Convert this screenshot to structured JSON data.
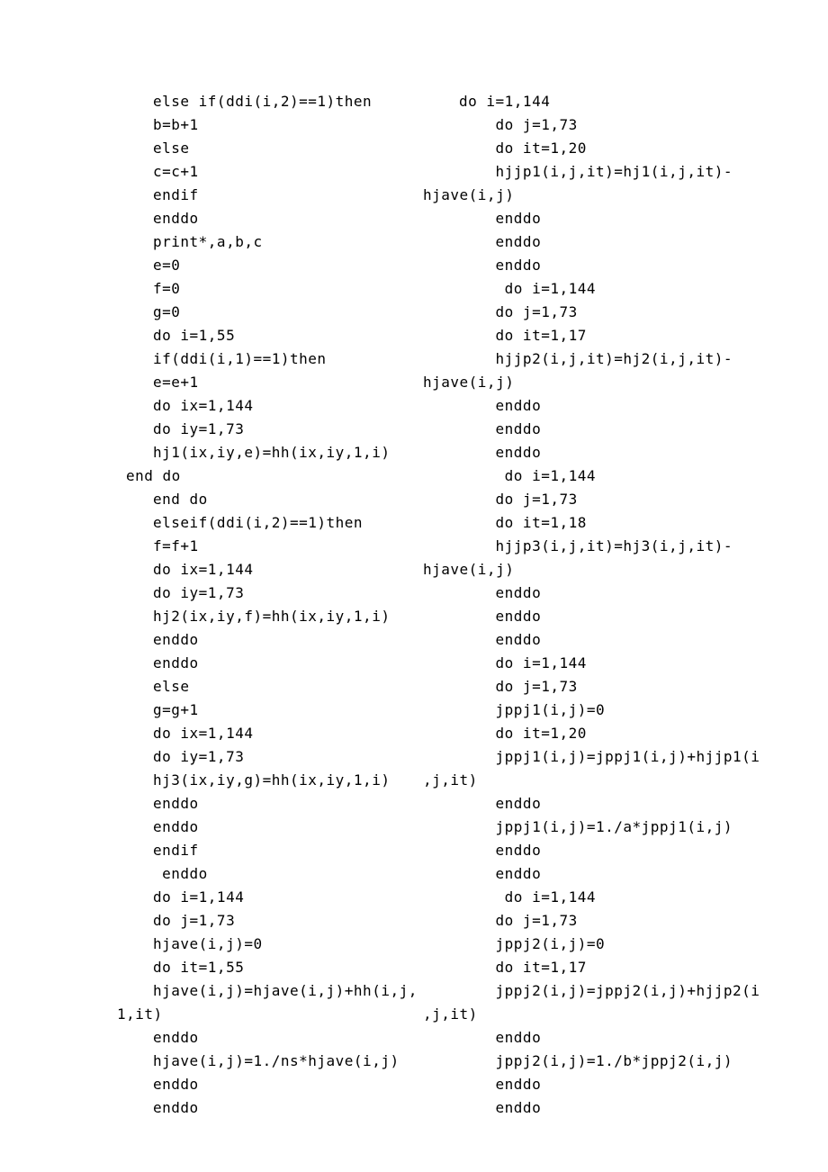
{
  "left": [
    {
      "cls": "indent",
      "t": "else if(ddi(i,2)==1)then"
    },
    {
      "cls": "indent",
      "t": "b=b+1"
    },
    {
      "cls": "indent",
      "t": "else"
    },
    {
      "cls": "indent",
      "t": "c=c+1"
    },
    {
      "cls": "indent",
      "t": "endif"
    },
    {
      "cls": "indent",
      "t": "enddo"
    },
    {
      "cls": "indent",
      "t": "print*,a,b,c"
    },
    {
      "cls": "indent",
      "t": "e=0"
    },
    {
      "cls": "indent",
      "t": "f=0"
    },
    {
      "cls": "indent",
      "t": "g=0"
    },
    {
      "cls": "indent",
      "t": "do i=1,55"
    },
    {
      "cls": "indent",
      "t": "if(ddi(i,1)==1)then"
    },
    {
      "cls": "indent",
      "t": "e=e+1"
    },
    {
      "cls": "indent",
      "t": "do ix=1,144"
    },
    {
      "cls": "indent",
      "t": "do iy=1,73"
    },
    {
      "cls": "indent",
      "t": "hj1(ix,iy,e)=hh(ix,iy,1,i)"
    },
    {
      "cls": "lessindent",
      "t": "end do"
    },
    {
      "cls": "indent",
      "t": "end do"
    },
    {
      "cls": "indent",
      "t": "elseif(ddi(i,2)==1)then"
    },
    {
      "cls": "indent",
      "t": "f=f+1"
    },
    {
      "cls": "indent",
      "t": "do ix=1,144"
    },
    {
      "cls": "indent",
      "t": "do iy=1,73"
    },
    {
      "cls": "indent",
      "t": "hj2(ix,iy,f)=hh(ix,iy,1,i)"
    },
    {
      "cls": "indent",
      "t": "enddo"
    },
    {
      "cls": "indent",
      "t": "enddo"
    },
    {
      "cls": "indent",
      "t": "else"
    },
    {
      "cls": "indent",
      "t": "g=g+1"
    },
    {
      "cls": "indent",
      "t": "do ix=1,144"
    },
    {
      "cls": "indent",
      "t": "do iy=1,73"
    },
    {
      "cls": "indent",
      "t": "hj3(ix,iy,g)=hh(ix,iy,1,i)"
    },
    {
      "cls": "indent",
      "t": "enddo"
    },
    {
      "cls": "indent",
      "t": "enddo"
    },
    {
      "cls": "indent",
      "t": "endif"
    },
    {
      "cls": "indent",
      "t": " enddo"
    },
    {
      "cls": "indent",
      "t": "do i=1,144"
    },
    {
      "cls": "indent",
      "t": "do j=1,73"
    },
    {
      "cls": "indent",
      "t": "hjave(i,j)=0"
    },
    {
      "cls": "indent",
      "t": "do it=1,55"
    },
    {
      "cls": "indent",
      "t": "hjave(i,j)=hjave(i,j)+hh(i,j,"
    },
    {
      "cls": "noindent",
      "t": "1,it)"
    },
    {
      "cls": "indent",
      "t": "enddo"
    },
    {
      "cls": "indent",
      "t": "hjave(i,j)=1./ns*hjave(i,j)"
    },
    {
      "cls": "indent",
      "t": "enddo"
    },
    {
      "cls": "indent",
      "t": "enddo"
    }
  ],
  "right": [
    {
      "cls": "indent",
      "t": "do i=1,144"
    },
    {
      "cls": "indent",
      "t": "    do j=1,73"
    },
    {
      "cls": "indent",
      "t": "    do it=1,20"
    },
    {
      "cls": "indent",
      "t": "    hjjp1(i,j,it)=hj1(i,j,it)-"
    },
    {
      "cls": "noindent",
      "t": "hjave(i,j)"
    },
    {
      "cls": "indent",
      "t": "    enddo"
    },
    {
      "cls": "indent",
      "t": "    enddo"
    },
    {
      "cls": "indent",
      "t": "    enddo"
    },
    {
      "cls": "indent",
      "t": "     do i=1,144"
    },
    {
      "cls": "indent",
      "t": "    do j=1,73"
    },
    {
      "cls": "indent",
      "t": "    do it=1,17"
    },
    {
      "cls": "indent",
      "t": "    hjjp2(i,j,it)=hj2(i,j,it)-"
    },
    {
      "cls": "noindent",
      "t": "hjave(i,j)"
    },
    {
      "cls": "indent",
      "t": "    enddo"
    },
    {
      "cls": "indent",
      "t": "    enddo"
    },
    {
      "cls": "indent",
      "t": "    enddo"
    },
    {
      "cls": "indent",
      "t": "     do i=1,144"
    },
    {
      "cls": "indent",
      "t": "    do j=1,73"
    },
    {
      "cls": "indent",
      "t": "    do it=1,18"
    },
    {
      "cls": "indent",
      "t": "    hjjp3(i,j,it)=hj3(i,j,it)-"
    },
    {
      "cls": "noindent",
      "t": "hjave(i,j)"
    },
    {
      "cls": "indent",
      "t": "    enddo"
    },
    {
      "cls": "indent",
      "t": "    enddo"
    },
    {
      "cls": "indent",
      "t": "    enddo"
    },
    {
      "cls": "indent",
      "t": "    do i=1,144"
    },
    {
      "cls": "indent",
      "t": "    do j=1,73"
    },
    {
      "cls": "indent",
      "t": "    jppj1(i,j)=0"
    },
    {
      "cls": "indent",
      "t": "    do it=1,20"
    },
    {
      "cls": "indent",
      "t": "    jppj1(i,j)=jppj1(i,j)+hjjp1(i"
    },
    {
      "cls": "noindent",
      "t": ",j,it)"
    },
    {
      "cls": "indent",
      "t": "    enddo"
    },
    {
      "cls": "indent",
      "t": "    jppj1(i,j)=1./a*jppj1(i,j)"
    },
    {
      "cls": "indent",
      "t": "    enddo"
    },
    {
      "cls": "indent",
      "t": "    enddo"
    },
    {
      "cls": "indent",
      "t": "     do i=1,144"
    },
    {
      "cls": "indent",
      "t": "    do j=1,73"
    },
    {
      "cls": "indent",
      "t": "    jppj2(i,j)=0"
    },
    {
      "cls": "indent",
      "t": "    do it=1,17"
    },
    {
      "cls": "indent",
      "t": "    jppj2(i,j)=jppj2(i,j)+hjjp2(i"
    },
    {
      "cls": "noindent",
      "t": ",j,it)"
    },
    {
      "cls": "indent",
      "t": "    enddo"
    },
    {
      "cls": "indent",
      "t": "    jppj2(i,j)=1./b*jppj2(i,j)"
    },
    {
      "cls": "indent",
      "t": "    enddo"
    },
    {
      "cls": "indent",
      "t": "    enddo"
    }
  ]
}
